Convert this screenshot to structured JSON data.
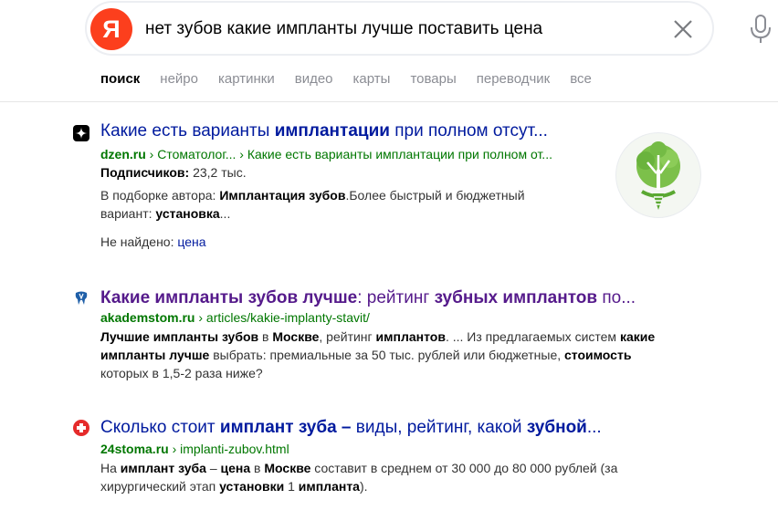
{
  "search": {
    "logo": "Я",
    "query": "нет зубов какие импланты лучше поставить цена"
  },
  "tabs": [
    "поиск",
    "нейро",
    "картинки",
    "видео",
    "карты",
    "товары",
    "переводчик",
    "все"
  ],
  "results": [
    {
      "title_parts": [
        "Какие есть варианты ",
        "имплантации",
        " при полном отсут..."
      ],
      "domain": "dzen.ru",
      "path": " › Стоматолог... › Какие есть варианты имплантации при полном от...",
      "subs_label": "Подписчиков:",
      "subs_value": " 23,2 тыс.",
      "snippet_line1_parts": [
        "В подборке автора: ",
        "Имплантация зубов",
        ".Более быстрый и бюджетный"
      ],
      "snippet_line2_parts": [
        "вариант: ",
        "установка",
        "..."
      ],
      "notfound_label": "Не найдено: ",
      "notfound_link": "цена"
    },
    {
      "title_parts": [
        "Какие импланты зубов лучше",
        ": рейтинг ",
        "зубных имплантов",
        " по..."
      ],
      "domain": "akademstom.ru",
      "path": " › articles/kakie-implanty-stavit/",
      "snippet_line1_parts": [
        "Лучшие импланты зубов",
        " в ",
        "Москве",
        ", рейтинг ",
        "имплантов",
        ". ... Из предлагаемых систем ",
        "какие"
      ],
      "snippet_line2_parts": [
        "импланты лучше",
        " выбрать: премиальные за 50 тыс. рублей или бюджетные, ",
        "стоимость"
      ],
      "snippet_line3": "которых в 1,5-2 раза ниже?"
    },
    {
      "title_parts": [
        "Сколько стоит ",
        "имплант зуба –",
        " виды, рейтинг, какой ",
        "зубной",
        "..."
      ],
      "domain": "24stoma.ru",
      "path": " › implanti-zubov.html",
      "snippet_line1_parts": [
        "На ",
        "имплант зуба",
        " – ",
        "цена",
        " в ",
        "Москве",
        " составит в среднем от 30 000 до 80 000 рублей (за"
      ],
      "snippet_line2_parts": [
        "хирургический этап ",
        "установки",
        " 1 ",
        "импланта",
        ")."
      ]
    }
  ],
  "colors": {
    "link": "#001a9e",
    "visited": "#551a8b",
    "url": "#007700",
    "logo": "#fc3f1d"
  }
}
